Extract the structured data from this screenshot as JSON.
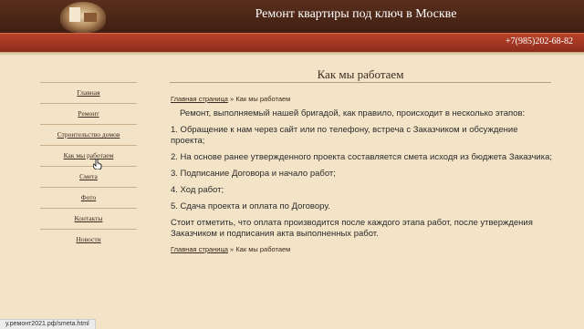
{
  "header": {
    "site_title": "Ремонт квартиры под ключ в Москве",
    "phone": "+7(985)202-68-82"
  },
  "page": {
    "heading": "Как мы работаем"
  },
  "sidebar": {
    "items": [
      {
        "label": "Главная"
      },
      {
        "label": "Ремонт"
      },
      {
        "label": "Строительство домов"
      },
      {
        "label": "Как мы работаем"
      },
      {
        "label": "Смета"
      },
      {
        "label": "Фото"
      },
      {
        "label": "Контакты"
      },
      {
        "label": "Новости"
      }
    ]
  },
  "breadcrumb": {
    "home": "Главная страница",
    "sep": " » ",
    "current": "Как мы работаем"
  },
  "content": {
    "intro": "Ремонт, выполняемый нашей бригадой, как правило, происходит в несколько этапов:",
    "steps": [
      "1. Обращение к нам через сайт или по телефону, встреча с Заказчиком и обсуждение проекта;",
      "2. На основе ранее утвержденного проекта составляется смета исходя из бюджета Заказчика;",
      "3. Подписание Договора и начало работ;",
      "4. Ход работ;",
      "5. Сдача проекта и оплата по Договору."
    ],
    "note": "Стоит отметить, что оплата производится после каждого этапа работ, после утверждения Заказчиком и подписания акта выполненных работ."
  },
  "status_bar": {
    "url": "у.ремонт2021.рф/smeta.html"
  },
  "icons": {
    "logo": "logo-icon",
    "cursor": "hand-cursor-icon"
  },
  "colors": {
    "header": "#4a2516",
    "bar": "#a53a24",
    "background": "#f3e4c8",
    "text": "#2b2b2b"
  }
}
